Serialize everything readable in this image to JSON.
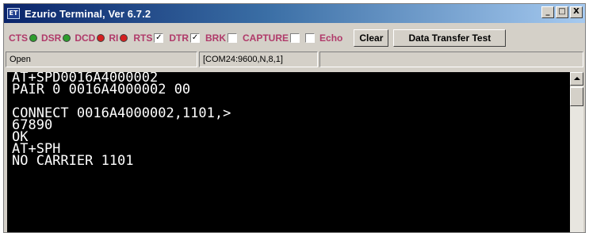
{
  "window": {
    "icon_label": "ET",
    "title": "Ezurio Terminal, Ver 6.7.2",
    "minimize": "_",
    "maximize": "□",
    "close": "X"
  },
  "toolbar": {
    "signals": [
      {
        "label": "CTS",
        "led_color": "#2e9e2e"
      },
      {
        "label": "DSR",
        "led_color": "#2e9e2e"
      },
      {
        "label": "DCD",
        "led_color": "#d42020"
      },
      {
        "label": "RI",
        "led_color": "#d42020"
      }
    ],
    "checkboxes": [
      {
        "label": "RTS",
        "checked": true,
        "mark": "✓"
      },
      {
        "label": "DTR",
        "checked": true,
        "mark": "✓"
      },
      {
        "label": "BRK",
        "checked": false,
        "mark": ""
      },
      {
        "label": "CAPTURE",
        "checked": false,
        "mark": ""
      }
    ],
    "echo": {
      "label": "Echo",
      "checked": false,
      "mark": ""
    },
    "clear_label": "Clear",
    "data_transfer_label": "Data Transfer Test"
  },
  "statusbar": {
    "status": "Open",
    "port": "[COM24:9600,N,8,1]",
    "extra": ""
  },
  "terminal": {
    "lines": [
      "AT+SPD0016A4000002",
      "PAIR 0 0016A4000002 00",
      "",
      "CONNECT 0016A4000002,1101,>",
      "67890",
      "OK",
      "AT+SPH",
      "NO CARRIER 1101",
      "",
      "",
      "",
      ""
    ]
  },
  "colors": {
    "title_gradient_start": "#0a246a",
    "title_gradient_end": "#a6caf0",
    "label_color": "#b03a6a",
    "led_green": "#2e9e2e",
    "led_red": "#d42020",
    "terminal_bg": "#000000",
    "terminal_fg": "#ffffff"
  }
}
